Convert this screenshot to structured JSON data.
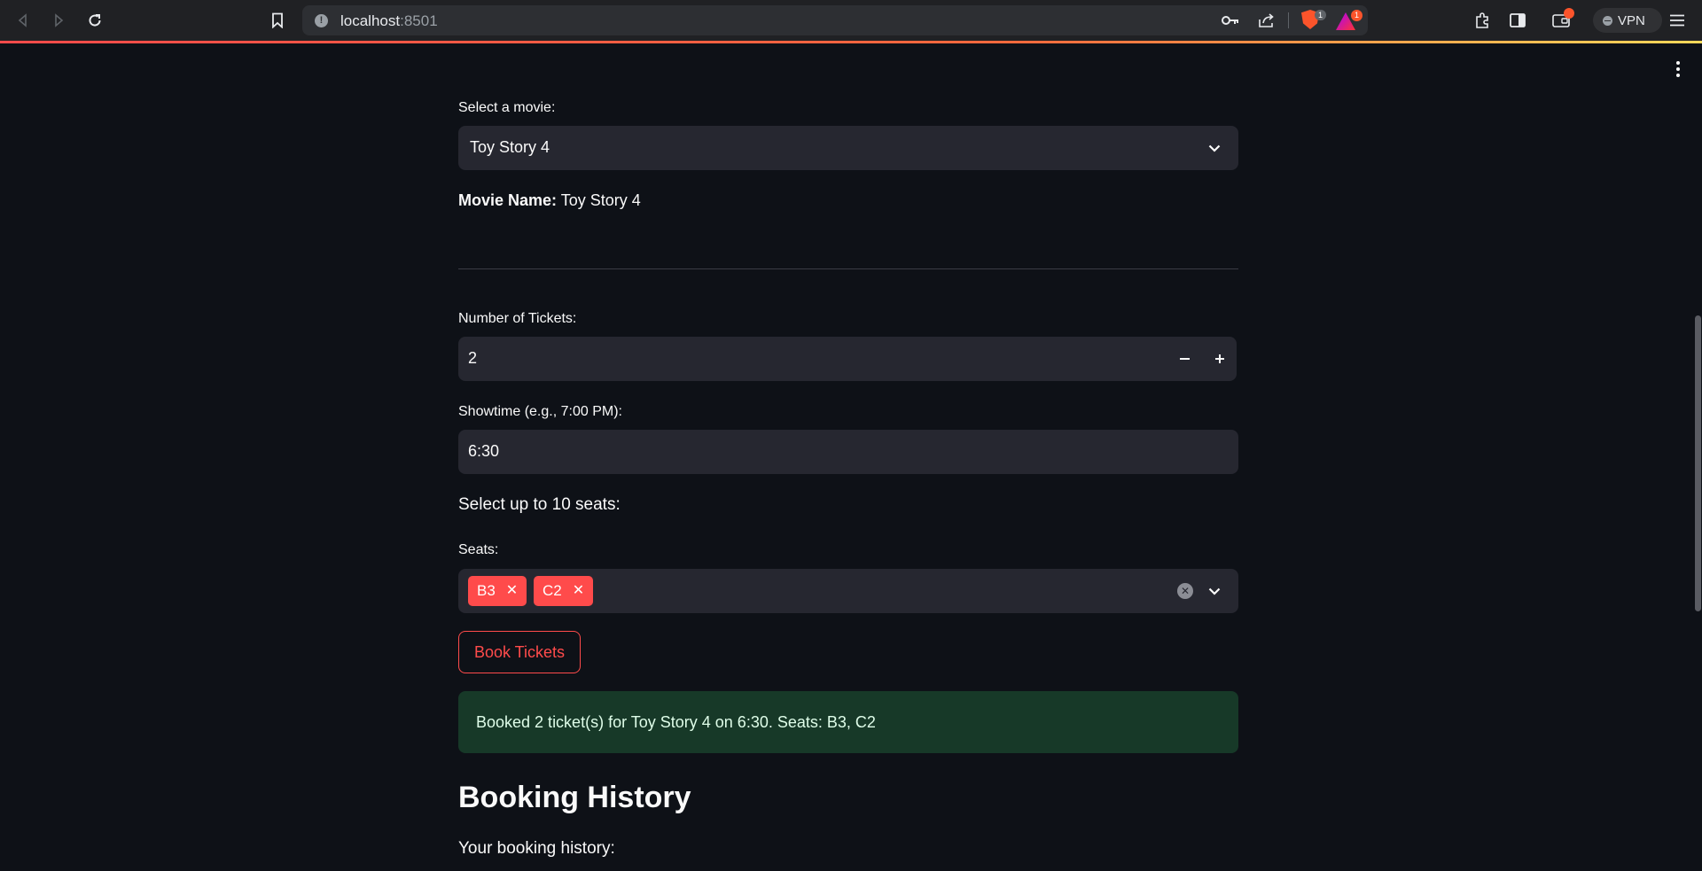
{
  "browser": {
    "url_host": "localhost",
    "url_port": ":8501",
    "brave_shield_count": "1",
    "rewards_count": "1",
    "vpn_label": "VPN"
  },
  "app": {
    "movie_select": {
      "label": "Select a movie:",
      "value": "Toy Story 4"
    },
    "movie_name": {
      "label": "Movie Name:",
      "value": "Toy Story 4"
    },
    "tickets": {
      "label": "Number of Tickets:",
      "value": "2"
    },
    "showtime": {
      "label": "Showtime (e.g., 7:00 PM):",
      "value": "6:30"
    },
    "seats_heading": "Select up to 10 seats:",
    "seats": {
      "label": "Seats:",
      "selected": [
        "B3",
        "C2"
      ]
    },
    "book_button": "Book Tickets",
    "success_message": "Booked 2 ticket(s) for Toy Story 4 on 6:30. Seats: B3, C2",
    "history_title": "Booking History",
    "history_subtitle": "Your booking history:"
  },
  "colors": {
    "background": "#0e1117",
    "widget": "#262730",
    "accent": "#ff4b4b",
    "success_bg": "#173928"
  }
}
